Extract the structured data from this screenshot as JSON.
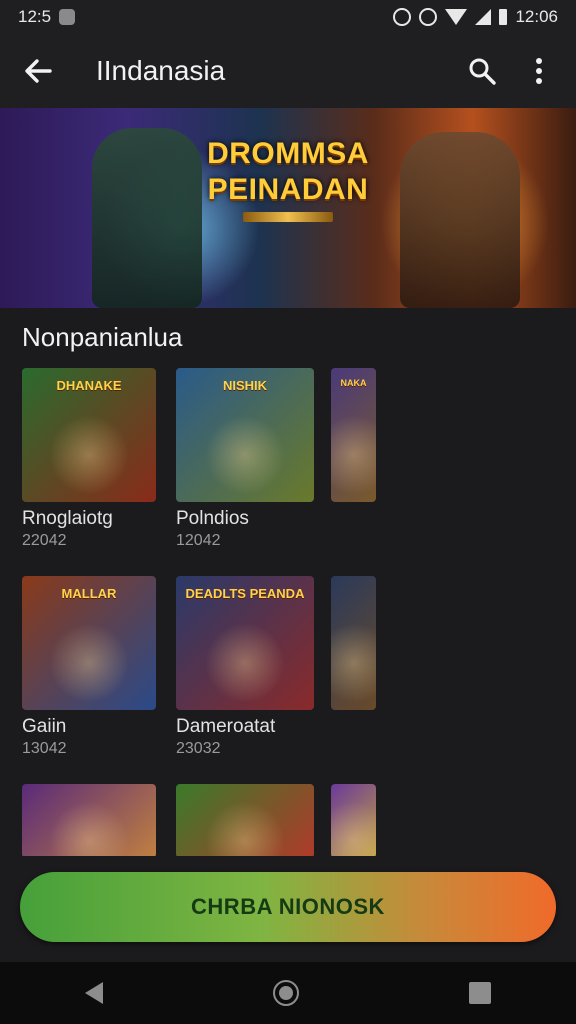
{
  "status_bar": {
    "time_left": "12:5",
    "time_right": "12:06"
  },
  "app_bar": {
    "title": "IIndanasia",
    "back_icon": "arrow-left-icon",
    "search_icon": "search-icon",
    "menu_icon": "more-vert-icon"
  },
  "hero": {
    "title_line1": "DROMMSA",
    "title_line2": "PEINADAN"
  },
  "section": {
    "title": "Nonpanianlua"
  },
  "cards": [
    {
      "name": "Rnoglaiotg",
      "meta": "22042",
      "label": "DHANAKE",
      "col": "#2a6b2e",
      "col2": "#8a2a1a"
    },
    {
      "name": "Polndios",
      "meta": "12042",
      "label": "NISHIK",
      "col": "#2a5a8a",
      "col2": "#6a7a2a"
    },
    {
      "name": "",
      "meta": "",
      "label": "NAKA",
      "col": "#4a3a7a",
      "col2": "#7a5a2a"
    },
    {
      "name": "Gaiin",
      "meta": "13042",
      "label": "MALLAR",
      "col": "#8a3a1a",
      "col2": "#2a4a8a"
    },
    {
      "name": "Dameroatat",
      "meta": "23032",
      "label": "DEADLTS PEANDA",
      "col": "#2a3a6a",
      "col2": "#8a2a2a"
    },
    {
      "name": "",
      "meta": "",
      "label": "",
      "col": "#2a3a5a",
      "col2": "#6a4a2a"
    },
    {
      "name": "",
      "meta": "",
      "label": "",
      "col": "#5a2a7a",
      "col2": "#c08040"
    },
    {
      "name": "",
      "meta": "",
      "label": "",
      "col": "#3a7a2a",
      "col2": "#b03a2a"
    },
    {
      "name": "",
      "meta": "",
      "label": "",
      "col": "#6a3a9a",
      "col2": "#c0a040"
    }
  ],
  "cta": {
    "label": "CHRBA NIONOSK"
  },
  "nav": {
    "back": "nav-back-icon",
    "home": "nav-home-icon",
    "recents": "nav-recents-icon"
  }
}
